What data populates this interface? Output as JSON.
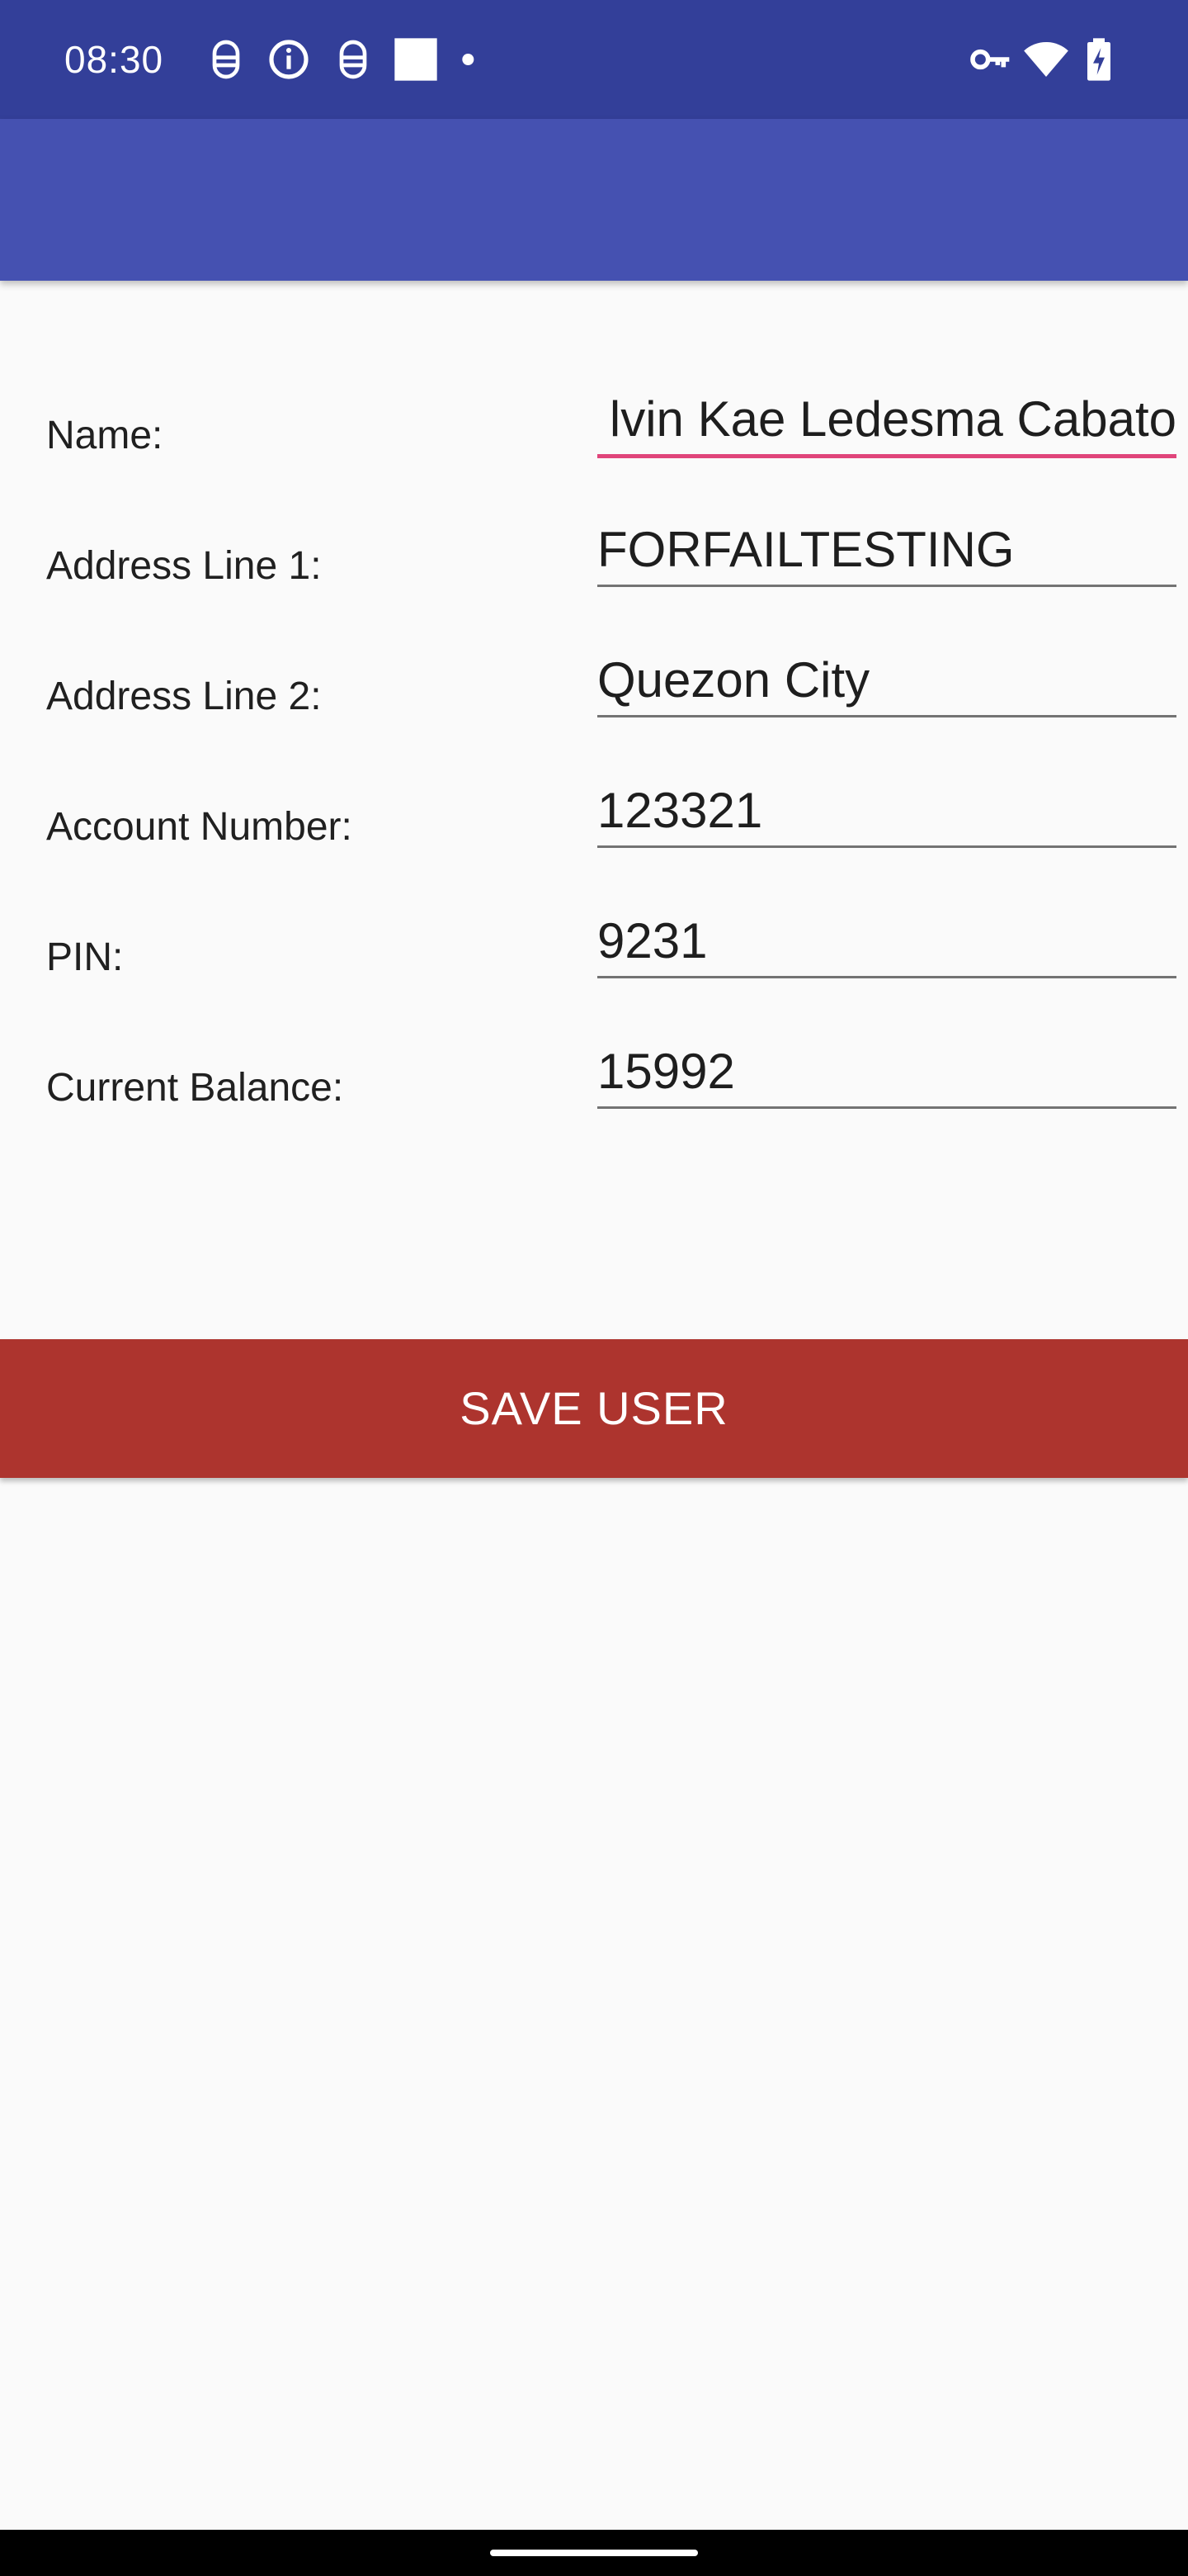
{
  "status_bar": {
    "time": "08:30",
    "background": "#333f99",
    "left_icons": [
      "notification-bug-icon",
      "info-icon",
      "notification-bug-icon",
      "square-notification-icon",
      "more-notifications-dot-icon"
    ],
    "right_icons": [
      "vpn-key-icon",
      "wifi-icon",
      "battery-charging-icon"
    ]
  },
  "app_bar": {
    "background": "#4551b1"
  },
  "form": {
    "accent_color": "#e0457b",
    "rows": [
      {
        "label": "Name:",
        "value": "lvin Kae Ledesma Cabato",
        "focused": true
      },
      {
        "label": "Address Line 1:",
        "value": "FORFAILTESTING",
        "focused": false
      },
      {
        "label": "Address Line 2:",
        "value": "Quezon City",
        "focused": false
      },
      {
        "label": "Account Number:",
        "value": "123321",
        "focused": false
      },
      {
        "label": "PIN:",
        "value": "9231",
        "focused": false
      },
      {
        "label": "Current Balance:",
        "value": "15992",
        "focused": false
      }
    ]
  },
  "save_button": {
    "label": "SAVE USER",
    "background": "#ad342e"
  }
}
